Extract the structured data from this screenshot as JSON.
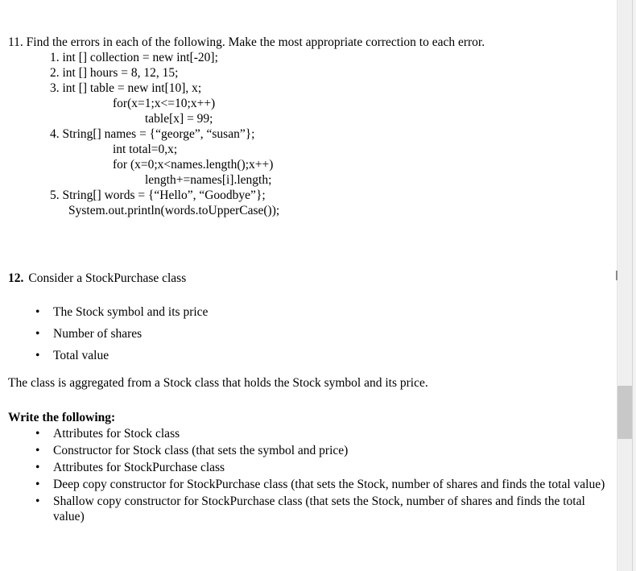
{
  "question11": {
    "heading": "11. Find the errors in each of the following. Make the most appropriate correction to each error.",
    "code_lines": [
      {
        "indent": 1,
        "text": "1. int [] collection = new int[-20];"
      },
      {
        "indent": 1,
        "text": "2. int [] hours = 8, 12, 15;"
      },
      {
        "indent": 1,
        "text": "3. int [] table = new int[10], x;"
      },
      {
        "indent": 3,
        "text": "for(x=1;x<=10;x++)"
      },
      {
        "indent": 4,
        "text": "table[x] = 99;"
      },
      {
        "indent": 1,
        "text": "4. String[] names = {“george”, “susan”};"
      },
      {
        "indent": 3,
        "text": "int total=0,x;"
      },
      {
        "indent": 3,
        "text": "for (x=0;x<names.length();x++)"
      },
      {
        "indent": 4,
        "text": "length+=names[i].length;"
      },
      {
        "indent": 1,
        "text": "5. String[] words = {“Hello”, “Goodbye”};"
      },
      {
        "indent": 2,
        "text": "System.out.println(words.toUpperCase());"
      }
    ]
  },
  "question12": {
    "number": "12.",
    "title": "Consider a StockPurchase class",
    "bullet_marker": "•",
    "requirements": [
      "The Stock symbol and its price",
      "Number of shares",
      "Total value"
    ],
    "aggregation_note": "The class is aggregated from a Stock class that holds the Stock symbol and its price.",
    "write_heading": "Write the following:",
    "tasks": [
      "Attributes for Stock class",
      "Constructor for Stock class (that sets the symbol and price)",
      "Attributes for StockPurchase class",
      "Deep copy constructor for StockPurchase class (that sets the Stock, number of shares and finds the total value)",
      "Shallow copy constructor for StockPurchase class (that sets the Stock, number of shares and finds the total value)"
    ]
  },
  "scrollbar": {
    "thumb_position_label": "",
    "track_color": "#efefef",
    "thumb_color": "#c8c8c8"
  },
  "colors": {
    "page_background": "#ffffff",
    "text": "#000000",
    "chrome_background": "#f0f0f0"
  }
}
